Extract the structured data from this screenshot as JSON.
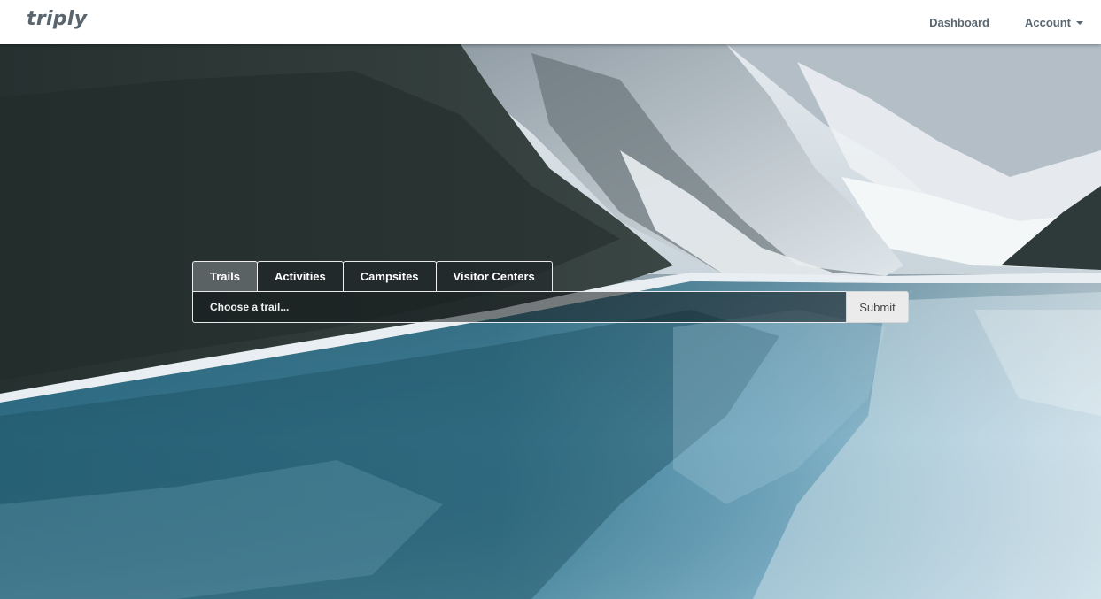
{
  "brand": {
    "name": "triply"
  },
  "nav": {
    "dashboard_label": "Dashboard",
    "account_label": "Account"
  },
  "search": {
    "tabs": [
      {
        "label": "Trails",
        "active": true
      },
      {
        "label": "Activities",
        "active": false
      },
      {
        "label": "Campsites",
        "active": false
      },
      {
        "label": "Visitor Centers",
        "active": false
      }
    ],
    "placeholder": "Choose a trail...",
    "submit_label": "Submit"
  },
  "colors": {
    "brand_text": "#59656e",
    "nav_text": "#5b6770",
    "navbar_bg": "#ffffff"
  },
  "icons": {
    "account_dropdown": "caret-down-icon"
  }
}
